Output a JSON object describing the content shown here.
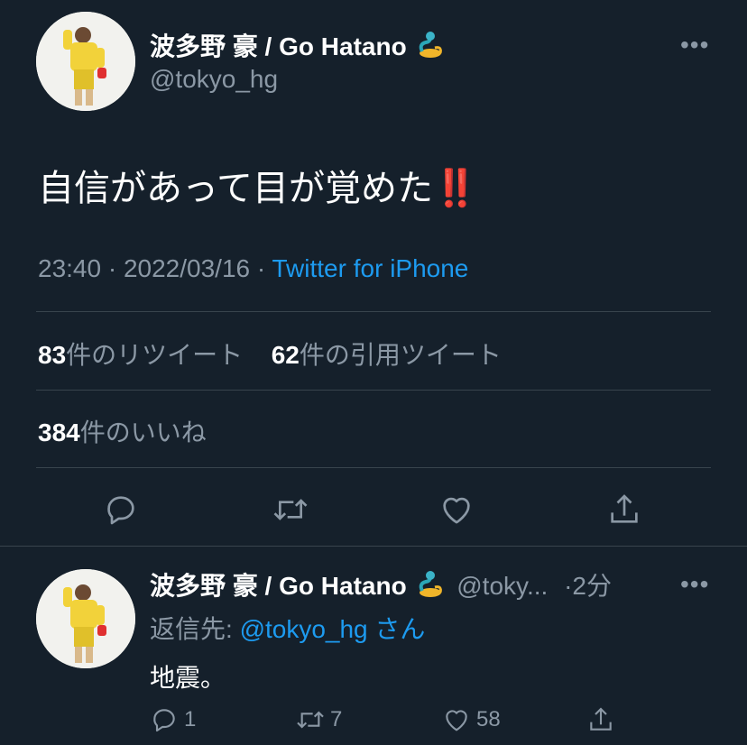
{
  "main_tweet": {
    "author_name": "波多野 豪 / Go Hatano",
    "author_handle": "@tokyo_hg",
    "text": "自信があって目が覚めた‼️",
    "time": "23:40",
    "date": "2022/03/16",
    "source": "Twitter for iPhone",
    "retweets_count": "83",
    "retweets_label": "件のリツイート",
    "quotes_count": "62",
    "quotes_label": "件の引用ツイート",
    "likes_count": "384",
    "likes_label": "件のいいね",
    "more": "•••"
  },
  "reply_tweet": {
    "author_name": "波多野 豪 / Go Hatano",
    "author_handle": "@toky...",
    "age": "·2分",
    "reply_to_label": "返信先:",
    "reply_to_handle": "@tokyo_hg",
    "reply_to_suffix": "さん",
    "text": "地震。",
    "reply_count": "1",
    "retweet_count": "7",
    "like_count": "58",
    "more": "•••"
  },
  "icons": [
    "reply-icon",
    "retweet-icon",
    "like-icon",
    "share-icon",
    "genie-emoji-icon",
    "more-icon"
  ],
  "colors": {
    "background": "#15202b",
    "text": "#ffffff",
    "muted": "#8b98a5",
    "link": "#1d9bf0",
    "divider": "#38444d"
  }
}
